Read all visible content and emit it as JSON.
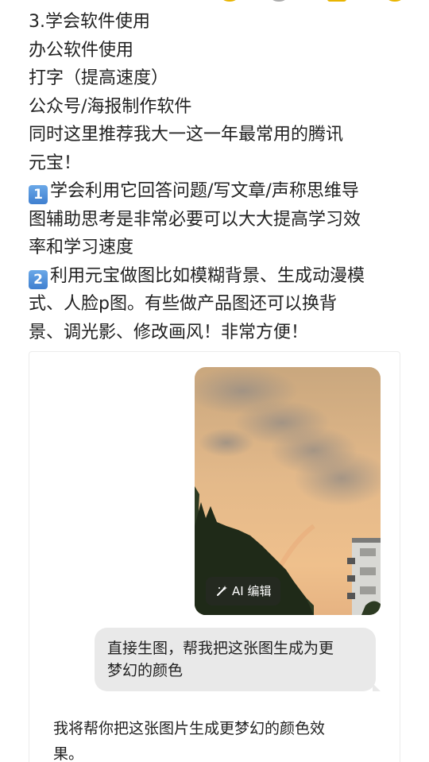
{
  "post": {
    "lines": [
      "3.学会软件使用",
      "办公软件使用",
      "打字（提高速度）",
      "公众号/海报制作软件",
      "同时这里推荐我大一这一年最常用的腾讯",
      "元宝！"
    ],
    "point1": {
      "badge": "1",
      "line1": "学会利用它回答问题/写文章/声称思维导",
      "line2": "图辅助思考是非常必要可以大大提高学习效",
      "line3": "率和学习速度"
    },
    "point2": {
      "badge": "2",
      "line1": "利用元宝做图比如模糊背景、生成动漫模",
      "line2": "式、人脸p图。有些做产品图还可以换背",
      "line3": "景、调光影、修改画风！非常方便！"
    }
  },
  "chat": {
    "image_button_label": "AI 编辑",
    "user_message_line1": "直接生图，帮我把这张图生成为更",
    "user_message_line2": "梦幻的颜色",
    "bot_reply_line1": "我将帮你把这张图片生成更梦幻的颜色效",
    "bot_reply_line2": "果。"
  },
  "icons": {
    "ai_edit": "magic-wand-icon",
    "badge_color": "#4a90d9"
  }
}
